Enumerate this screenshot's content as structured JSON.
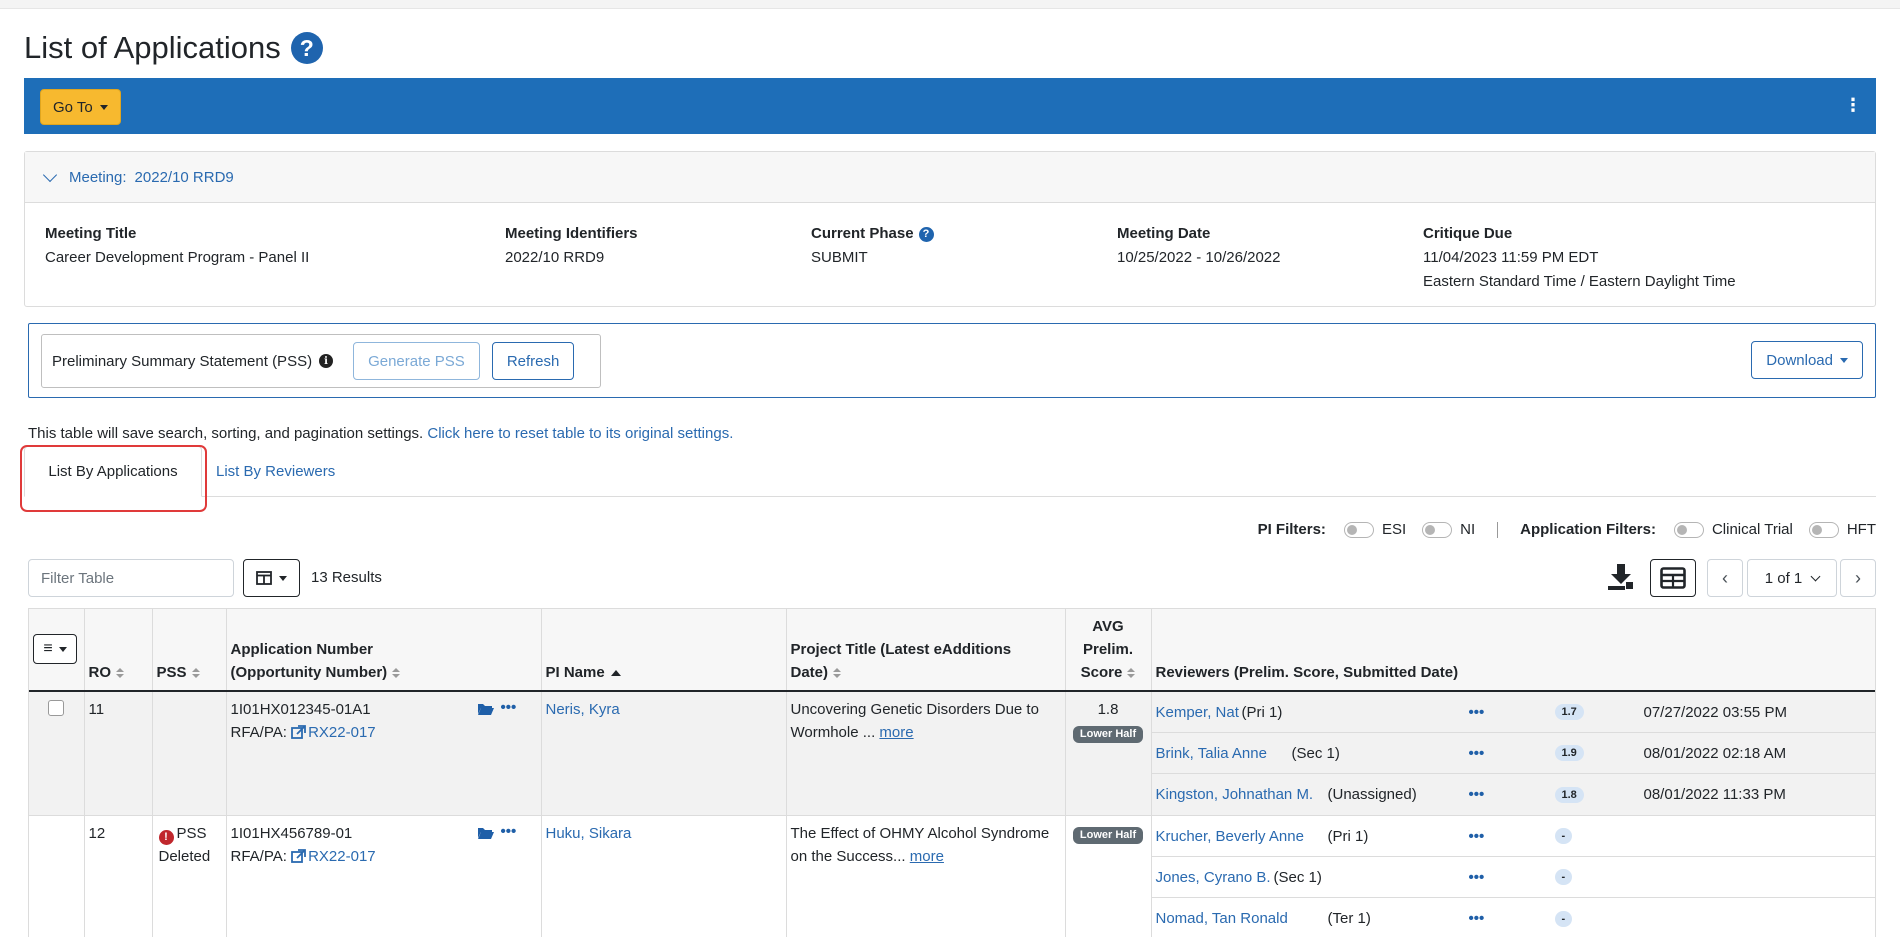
{
  "page": {
    "title": "List of Applications"
  },
  "toolbar": {
    "goto_label": "Go To",
    "more_menu": "⋮"
  },
  "meeting": {
    "header_label": "Meeting:",
    "header_value": "2022/10 RRD9",
    "cols": [
      {
        "label": "Meeting Title",
        "value": "Career Development Program - Panel II"
      },
      {
        "label": "Meeting Identifiers",
        "value": "2022/10 RRD9"
      },
      {
        "label": "Current Phase",
        "value": "SUBMIT"
      },
      {
        "label": "Meeting Date",
        "value": "10/25/2022 - 10/26/2022"
      },
      {
        "label": "Critique Due",
        "value": "11/04/2023 11:59 PM EDT",
        "value2": "Eastern Standard Time / Eastern Daylight Time"
      }
    ]
  },
  "pss": {
    "label": "Preliminary Summary Statement (PSS)",
    "generate_label": "Generate PSS",
    "refresh_label": "Refresh",
    "download_label": "Download"
  },
  "note": {
    "text": "This table will save search, sorting, and pagination settings.",
    "link": "Click here to reset table to its original settings."
  },
  "tabs": {
    "active": "List By Applications",
    "other": "List By Reviewers"
  },
  "filters": {
    "pi_label": "PI Filters:",
    "pi_options": [
      "ESI",
      "NI"
    ],
    "app_label": "Application Filters:",
    "app_options": [
      "Clinical Trial",
      "HFT"
    ]
  },
  "table_controls": {
    "filter_placeholder": "Filter Table",
    "results": "13 Results",
    "page_label": "1 of 1"
  },
  "table": {
    "headers": {
      "ro": "RO",
      "pss": "PSS",
      "app_line1": "Application Number",
      "app_line2": "(Opportunity Number)",
      "pi": "PI Name",
      "title_line1": "Project Title (Latest eAdditions",
      "title_line2": "Date)",
      "avg_line1": "AVG",
      "avg_line2": "Prelim.",
      "avg_line3": "Score",
      "reviewers": "Reviewers (Prelim. Score, Submitted Date)"
    },
    "rows": [
      {
        "ro": "11",
        "pss_status": "",
        "app_number": "1I01HX012345-01A1",
        "rfa_label": "RFA/PA:",
        "rfa_link": "RX22-017",
        "pi": "Neris, Kyra",
        "title": "Uncovering Genetic Disorders Due to Wormhole ...",
        "more": "more",
        "avg_score": "1.8",
        "half": "Lower Half",
        "reviewers": [
          {
            "name": "Kemper, Nat",
            "role": "(Pri 1)",
            "score": "1.7",
            "date": "07/27/2022 03:55 PM"
          },
          {
            "name": "Brink, Talia Anne",
            "role": "(Sec 1)",
            "score": "1.9",
            "date": "08/01/2022 02:18 AM"
          },
          {
            "name": "Kingston, Johnathan M.",
            "role": "(Unassigned)",
            "score": "1.8",
            "date": "08/01/2022 11:33 PM"
          }
        ]
      },
      {
        "ro": "12",
        "pss_status": "PSS Deleted",
        "app_number": "1I01HX456789-01",
        "rfa_label": "RFA/PA:",
        "rfa_link": "RX22-017",
        "pi": "Huku, Sikara",
        "title": "The Effect of OHMY Alcohol Syndrome on the Success...",
        "more": "more",
        "avg_score": "",
        "half": "Lower Half",
        "reviewers": [
          {
            "name": "Krucher, Beverly Anne",
            "role": "(Pri 1)",
            "score": "-",
            "date": ""
          },
          {
            "name": "Jones, Cyrano B.",
            "role": "(Sec 1)",
            "score": "-",
            "date": ""
          },
          {
            "name": "Nomad, Tan Ronald",
            "role": "(Ter 1)",
            "score": "-",
            "date": ""
          }
        ]
      }
    ]
  },
  "colors": {
    "brand_blue": "#1e6eb8",
    "goto_yellow": "#f7b92f",
    "link_blue": "#2a6ab0",
    "highlight_red": "#e03a3a"
  }
}
